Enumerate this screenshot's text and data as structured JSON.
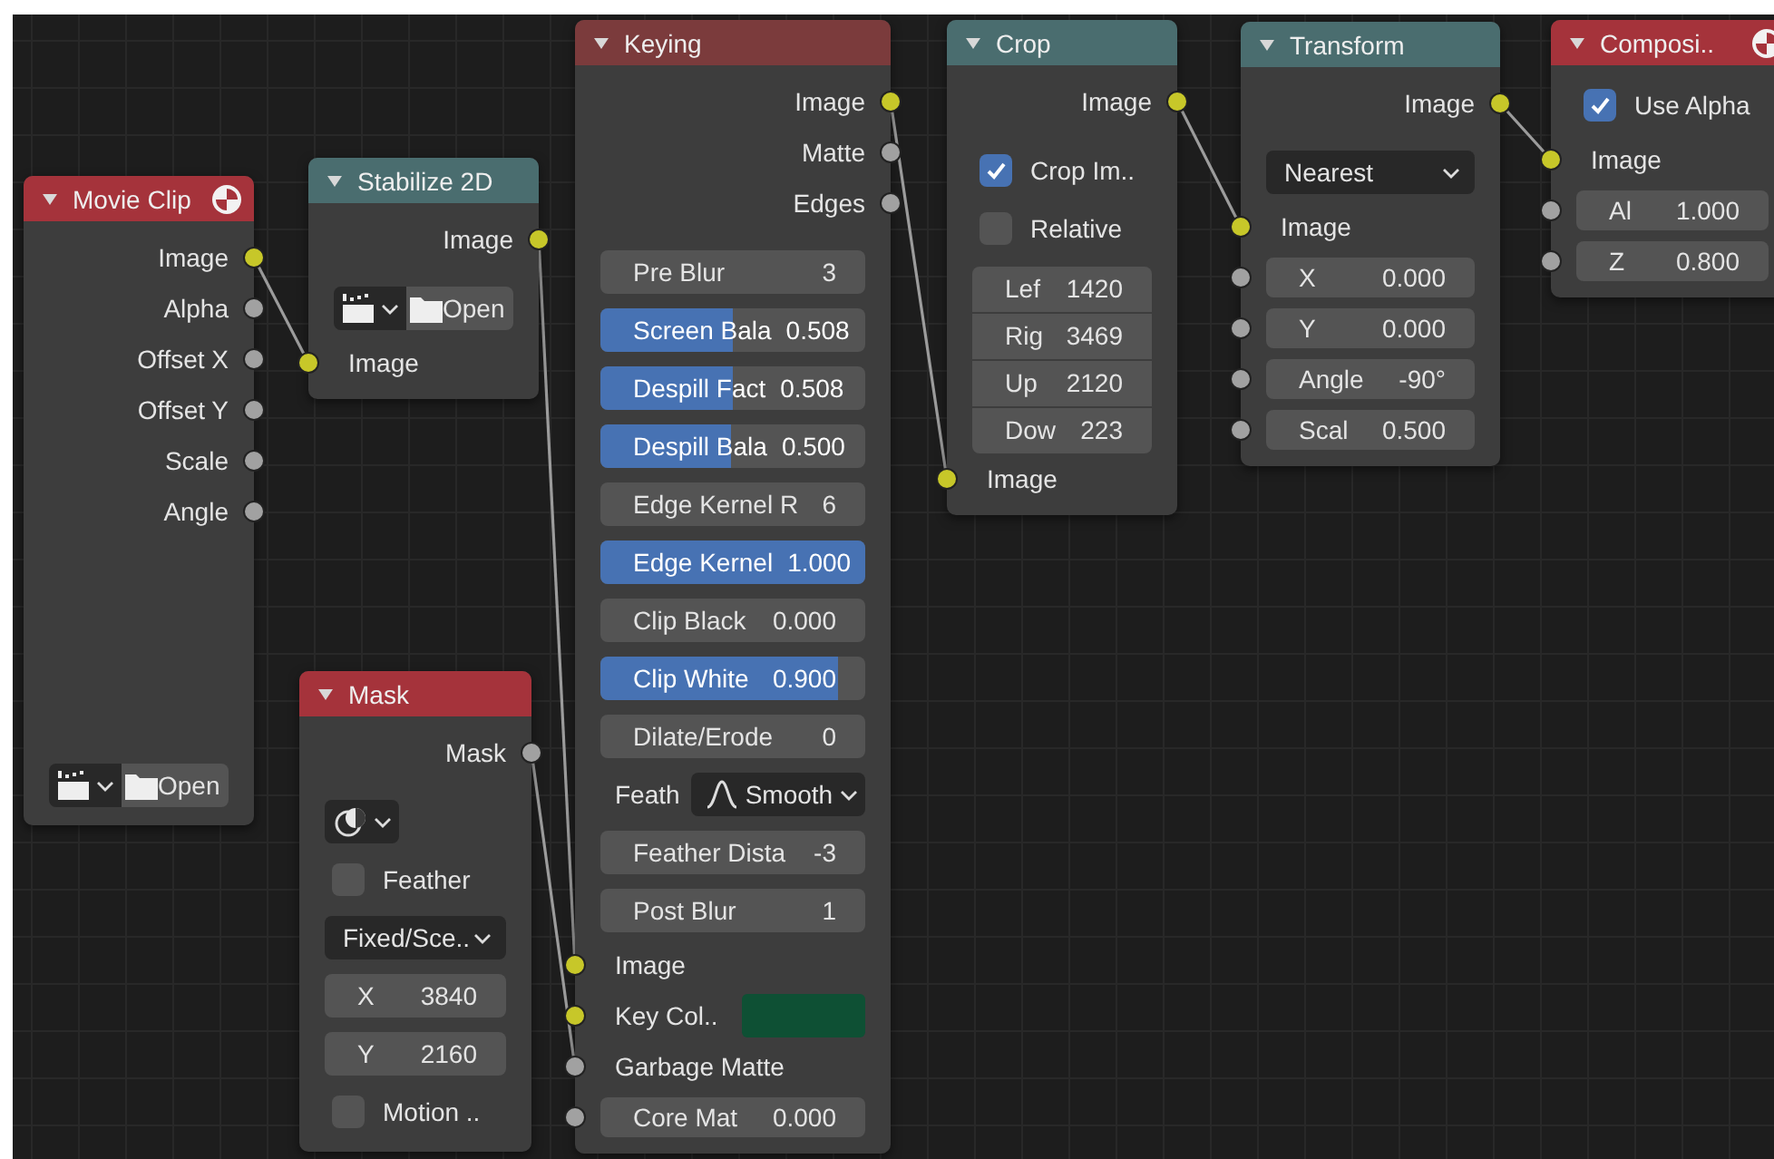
{
  "nodes": [
    {
      "title": "Movie Clip",
      "color": "#a5333b",
      "header_icon": true,
      "rows": [
        {
          "kind": "output",
          "label": "Image",
          "image": true
        },
        {
          "kind": "output",
          "label": "Alpha",
          "image": false
        },
        {
          "kind": "output",
          "label": "Offset X",
          "image": false
        },
        {
          "kind": "output",
          "label": "Offset Y",
          "image": false
        },
        {
          "kind": "output",
          "label": "Scale",
          "image": false
        },
        {
          "kind": "output",
          "label": "Angle",
          "image": false
        },
        {
          "kind": "datablock",
          "button": "Open"
        }
      ]
    },
    {
      "title": "Stabilize 2D",
      "color": "#4a6d6f",
      "header_icon": false,
      "rows": [
        {
          "kind": "output",
          "label": "Image",
          "image": true
        },
        {
          "kind": "datablock",
          "button": "Open"
        },
        {
          "kind": "input",
          "label": "Image",
          "image": true
        }
      ]
    },
    {
      "title": "Mask",
      "color": "#a5333b",
      "header_icon": false,
      "rows": [
        {
          "kind": "output",
          "label": "Mask",
          "image": false
        },
        {
          "kind": "icon_menu"
        },
        {
          "kind": "checkbox",
          "label": "Feather",
          "checked": false
        },
        {
          "kind": "dropdown",
          "value": "Fixed/Sce.."
        },
        {
          "kind": "number",
          "label": "X",
          "value": "3840"
        },
        {
          "kind": "number",
          "label": "Y",
          "value": "2160"
        },
        {
          "kind": "checkbox",
          "label": "Motion ..",
          "checked": false
        }
      ]
    },
    {
      "title": "Keying",
      "color": "#7b3b3c",
      "header_icon": false,
      "rows": [
        {
          "kind": "output",
          "label": "Image",
          "image": true
        },
        {
          "kind": "output",
          "label": "Matte",
          "image": false
        },
        {
          "kind": "output",
          "label": "Edges",
          "image": false
        },
        {
          "kind": "number",
          "label": "Pre Blur",
          "value": "3"
        },
        {
          "kind": "slider",
          "label": "Screen Bala",
          "value": "0.508",
          "level": 0.5
        },
        {
          "kind": "slider",
          "label": "Despill Fact",
          "value": "0.508",
          "level": 0.5
        },
        {
          "kind": "slider",
          "label": "Despill Bala",
          "value": "0.500",
          "level": 0.49
        },
        {
          "kind": "number",
          "label": "Edge Kernel R",
          "value": "6"
        },
        {
          "kind": "slider",
          "label": "Edge Kernel",
          "value": "1.000",
          "level": 1
        },
        {
          "kind": "number",
          "label": "Clip Black",
          "value": "0.000"
        },
        {
          "kind": "slider",
          "label": "Clip White",
          "value": "0.900",
          "level": 0.9
        },
        {
          "kind": "number",
          "label": "Dilate/Erode",
          "value": "0"
        },
        {
          "kind": "enum",
          "label": "Feath",
          "value": "Smooth"
        },
        {
          "kind": "number",
          "label": "Feather Dista",
          "value": "-3"
        },
        {
          "kind": "number",
          "label": "Post Blur",
          "value": "1"
        },
        {
          "kind": "input",
          "label": "Image",
          "image": true
        },
        {
          "kind": "color",
          "label": "Key Col..",
          "image": true,
          "color": "#0e5034"
        },
        {
          "kind": "input",
          "label": "Garbage Matte",
          "image": false
        },
        {
          "kind": "number",
          "label": "Core Mat",
          "value": "0.000",
          "socket": true,
          "image": false
        }
      ]
    },
    {
      "title": "Crop",
      "color": "#4a6d6f",
      "header_icon": false,
      "rows": [
        {
          "kind": "output",
          "label": "Image",
          "image": true
        },
        {
          "kind": "checkbox",
          "label": "Crop Im..",
          "checked": true
        },
        {
          "kind": "checkbox",
          "label": "Relative",
          "checked": false
        },
        {
          "kind": "joined",
          "label": "Lef",
          "value": "1420"
        },
        {
          "kind": "joined",
          "label": "Rig",
          "value": "3469"
        },
        {
          "kind": "joined",
          "label": "Up",
          "value": "2120"
        },
        {
          "kind": "joined",
          "label": "Dow",
          "value": "223"
        },
        {
          "kind": "input",
          "label": "Image",
          "image": true
        }
      ]
    },
    {
      "title": "Transform",
      "color": "#4a6d6f",
      "header_icon": false,
      "rows": [
        {
          "kind": "output",
          "label": "Image",
          "image": true
        },
        {
          "kind": "dropdown",
          "value": "Nearest"
        },
        {
          "kind": "input",
          "label": "Image",
          "image": true
        },
        {
          "kind": "number",
          "label": "X",
          "value": "0.000",
          "socket": true,
          "image": false
        },
        {
          "kind": "number",
          "label": "Y",
          "value": "0.000",
          "socket": true,
          "image": false
        },
        {
          "kind": "number",
          "label": "Angle",
          "value": "-90°",
          "socket": true,
          "image": false
        },
        {
          "kind": "number",
          "label": "Scal",
          "value": "0.500",
          "socket": true,
          "image": false
        }
      ]
    },
    {
      "title": "Composi..",
      "color": "#a5333b",
      "header_icon": true,
      "rows": [
        {
          "kind": "checkbox",
          "label": "Use Alpha",
          "checked": true
        },
        {
          "kind": "input",
          "label": "Image",
          "image": true
        },
        {
          "kind": "number",
          "label": "Al",
          "value": "1.000",
          "socket": true,
          "image": false
        },
        {
          "kind": "number",
          "label": "Z",
          "value": "0.800",
          "socket": true,
          "image": false
        }
      ]
    }
  ]
}
